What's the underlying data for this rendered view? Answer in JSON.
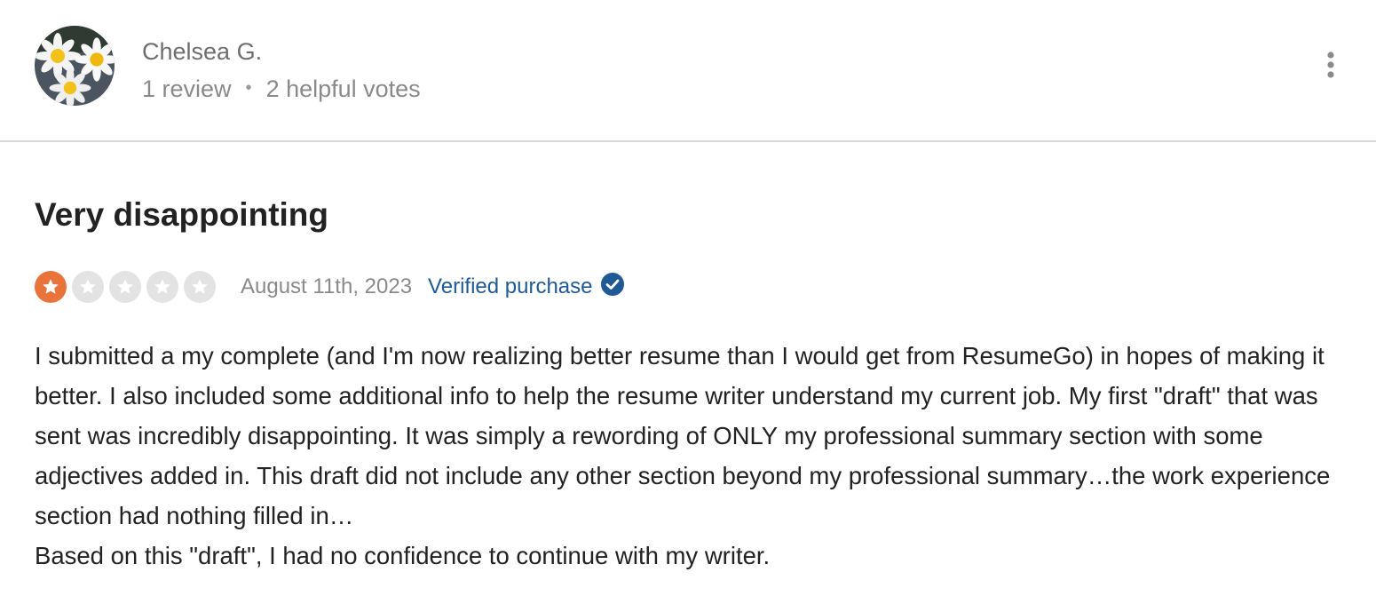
{
  "reviewer": {
    "name": "Chelsea G.",
    "reviews": "1 review",
    "separator": "•",
    "helpful_votes": "2 helpful votes",
    "avatar_icon": "daisy-flowers-avatar"
  },
  "menu": {
    "icon": "more-vertical-icon"
  },
  "review": {
    "title": "Very disappointing",
    "rating": 1,
    "rating_max": 5,
    "date": "August 11th, 2023",
    "verified_label": "Verified purchase",
    "verified_icon": "check-circle-icon",
    "body": [
      "I submitted a my complete (and I'm now realizing better resume than I would get from ResumeGo) in hopes of making it better. I also included some additional info to help the resume writer understand my current job. My first \"draft\" that was sent was incredibly disappointing. It was simply a rewording of ONLY my professional summary section with some adjectives added in. This draft did not include any other section beyond my professional summary…the work experience section had nothing filled in…",
      "Based on this \"draft\", I had no confidence to continue with my writer."
    ]
  },
  "colors": {
    "star_filled": "#e8743b",
    "star_empty": "#e3e3e3",
    "verified": "#1f5a96"
  }
}
